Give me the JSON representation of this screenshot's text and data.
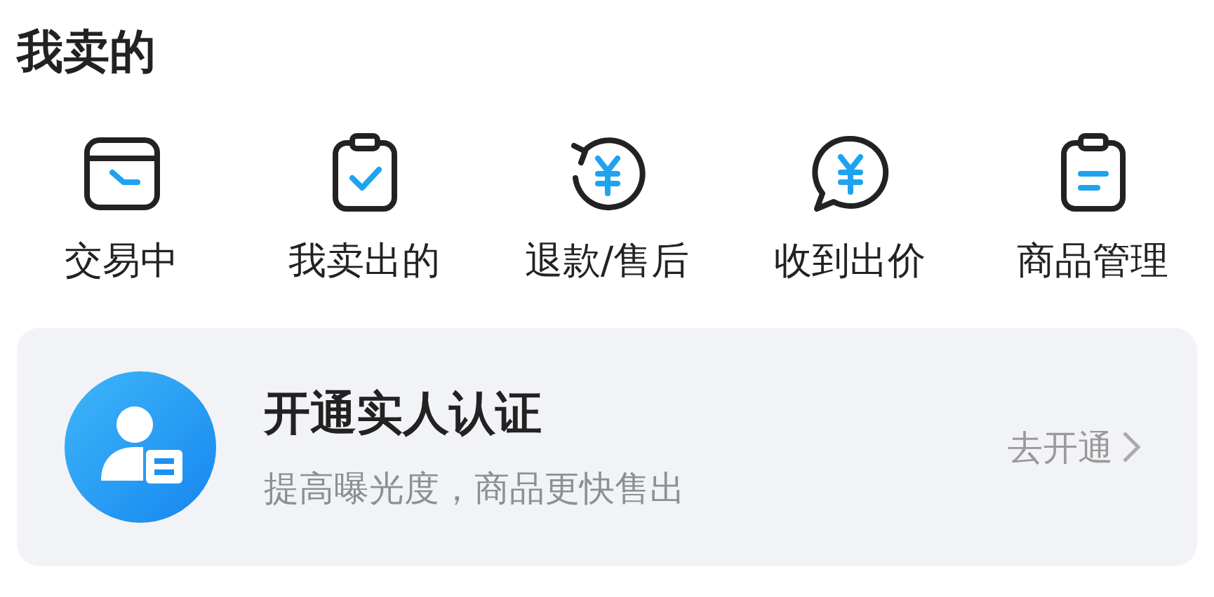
{
  "title": "我卖的",
  "shortcuts": [
    {
      "label": "交易中",
      "kind": "wallet"
    },
    {
      "label": "我卖出的",
      "kind": "check"
    },
    {
      "label": "退款/售后",
      "kind": "refund"
    },
    {
      "label": "收到出价",
      "kind": "offer"
    },
    {
      "label": "商品管理",
      "kind": "list"
    }
  ],
  "verification_card": {
    "title": "开通实人认证",
    "subtitle": "提高曝光度，商品更快售出",
    "action": "去开通"
  }
}
